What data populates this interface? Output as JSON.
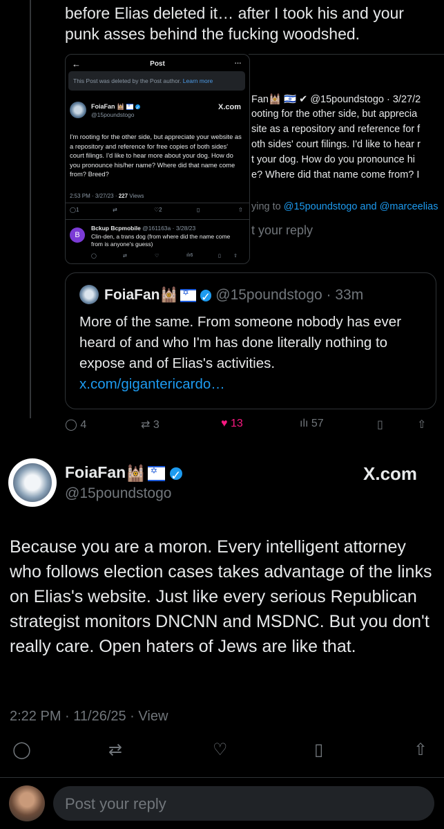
{
  "top_text": "before Elias deleted it… after I took his and your punk asses behind the fucking woodshed.",
  "shot": {
    "back_icon": "arrow-left-icon",
    "title": "Post",
    "more": "···",
    "deleted_notice": "This Post was deleted by the Post author.",
    "learn_more": "Learn more",
    "name": "FoiaFan",
    "handle": "@15poundstogo",
    "xcom": "X.com",
    "body": "I'm rooting for the other side, but appreciate your website as a repository and reference for free copies of both sides' court filings. I'd like to hear more about your dog. How do you pronounce his/her name? Where did that name come from?  Breed?",
    "meta_time": "2:53 PM · 3/27/23 · ",
    "views_count": "227",
    "views_label": " Views",
    "replies": "1",
    "likes": "2",
    "reply_name": "Bckup Bcpmobile",
    "reply_handle": "@161163a · 3/28/23",
    "reply_avatar_letter": "B",
    "reply_body": "Clin-den, a trans dog (from where did the name come from is anyone's guess)",
    "reply_views": "6"
  },
  "shot2": {
    "l1": "Fan🕍 🇮🇱 ✔ @15poundstogo · 3/27/2",
    "l2": "ooting for the other side, but apprecia",
    "l3": "site as a repository and reference for f",
    "l4": "oth sides' court filings. I'd like to hear r",
    "l5": "t your dog. How do you pronounce hi",
    "l6": "e? Where did that name come from?  I",
    "l7a": "ying to ",
    "l7b": "@15poundstogo and @marceelias",
    "l8": "t your reply"
  },
  "quote": {
    "name": "FoiaFan",
    "handle": "@15poundstogo · 33m",
    "body": "More of the same. From someone nobody has ever heard of and who I'm has done literally nothing to expose and of Elias's activities.",
    "link": "x.com/gigantericardo…"
  },
  "quote_actions": {
    "replies": "4",
    "reposts": "3",
    "likes": "13",
    "views": "57"
  },
  "main": {
    "name": "FoiaFan",
    "handle": "@15poundstogo",
    "xcom": "X.com",
    "body": "Because you are a moron. Every intelligent attorney who follows election cases takes advantage of the links on Elias's website. Just like every serious Republican strategist monitors DNCNN and MSDNC.  But you don't really care. Open haters of Jews are like that.",
    "meta": "2:22 PM · 11/26/25 · View"
  },
  "reply_placeholder": "Post your reply",
  "colors": {
    "accent": "#1d9bf0",
    "like": "#f91880",
    "muted": "#71767b"
  }
}
